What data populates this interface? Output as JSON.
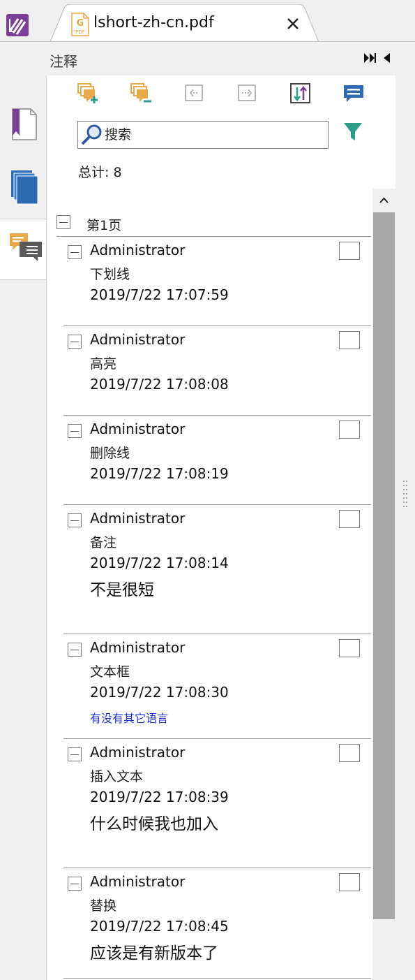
{
  "tab": {
    "title": "lshort-zh-cn.pdf",
    "pdf_icon_letter": "G",
    "pdf_icon_caption": "PDF"
  },
  "panel": {
    "title": "注释",
    "search_placeholder": "搜索",
    "total": "总计: 8",
    "page_label": "第1页"
  },
  "icons": {
    "app": "app-logo-icon",
    "toolbar": [
      "add-annotation-icon",
      "delete-annotation-icon",
      "import-icon",
      "export-icon",
      "sort-icon",
      "comment-icon"
    ],
    "side": [
      "bookmark-icon",
      "pages-icon",
      "annotations-icon"
    ]
  },
  "colors": {
    "accent_orange": "#e8a94a",
    "accent_blue": "#2d6bb3",
    "accent_purple": "#7b3f98",
    "accent_teal": "#2e9c8a",
    "link_blue": "#2233cc"
  },
  "annotations": [
    {
      "author": "Administrator",
      "type": "下划线",
      "time": "2019/7/22 17:07:59",
      "comment": ""
    },
    {
      "author": "Administrator",
      "type": "高亮",
      "time": "2019/7/22 17:08:08",
      "comment": ""
    },
    {
      "author": "Administrator",
      "type": "删除线",
      "time": "2019/7/22 17:08:19",
      "comment": ""
    },
    {
      "author": "Administrator",
      "type": "备注",
      "time": "2019/7/22 17:08:14",
      "comment": "不是很短"
    },
    {
      "author": "Administrator",
      "type": "文本框",
      "time": "2019/7/22 17:08:30",
      "comment": "有没有其它语言"
    },
    {
      "author": "Administrator",
      "type": "插入文本",
      "time": "2019/7/22 17:08:39",
      "comment": "什么时候我也加入"
    },
    {
      "author": "Administrator",
      "type": "替换",
      "time": "2019/7/22 17:08:45",
      "comment": "应该是有新版本了"
    }
  ]
}
